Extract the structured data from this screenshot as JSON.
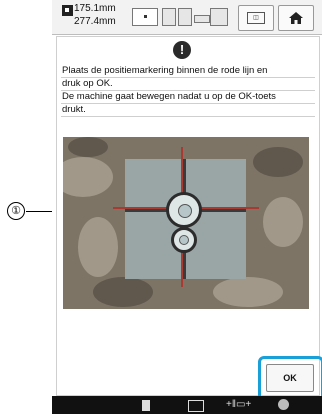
{
  "callout": {
    "number": "①"
  },
  "status_bar": {
    "width_value": "175.1mm",
    "height_value": "277.4mm"
  },
  "toolbar": {
    "rotate_label": "▯"
  },
  "message": {
    "lines": [
      "Plaats de positiemarkering binnen de rode lijn en",
      "druk op OK.",
      "De machine gaat bewegen nadat u op de OK-toets",
      "drukt."
    ]
  },
  "alert": {
    "symbol": "!"
  },
  "ok_button": {
    "label": "OK"
  },
  "colors": {
    "accent_highlight": "#1aa0d8",
    "guide_line": "#a83a32"
  },
  "icons": [
    "size-icon",
    "presser-foot-icon",
    "rotate-icon",
    "home-icon",
    "alert-icon",
    "page-icon",
    "grid-icon",
    "foot-icon",
    "gear-icon"
  ]
}
